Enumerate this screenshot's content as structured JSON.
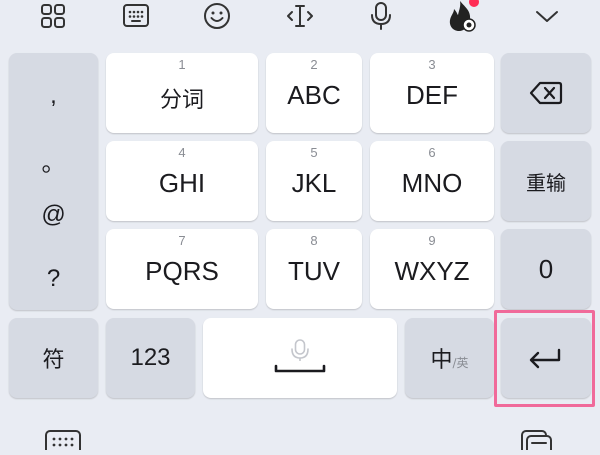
{
  "toolbar": {
    "icons": [
      "grid-icon",
      "keyboard-icon",
      "emoji-icon",
      "text-cursor-icon",
      "microphone-icon",
      "flame-icon",
      "chevron-down-icon"
    ],
    "notification_dot_color": "#ff2d55"
  },
  "punctuation": [
    ",",
    "。",
    "@",
    "?"
  ],
  "keys": {
    "k1": {
      "num": "1",
      "label": "分词"
    },
    "k2": {
      "num": "2",
      "label": "ABC"
    },
    "k3": {
      "num": "3",
      "label": "DEF"
    },
    "k4": {
      "num": "4",
      "label": "GHI"
    },
    "k5": {
      "num": "5",
      "label": "JKL"
    },
    "k6": {
      "num": "6",
      "label": "MNO"
    },
    "k7": {
      "num": "7",
      "label": "PQRS"
    },
    "k8": {
      "num": "8",
      "label": "TUV"
    },
    "k9": {
      "num": "9",
      "label": "WXYZ"
    }
  },
  "right_column": {
    "retype": "重输",
    "zero": "0"
  },
  "bottom_row": {
    "symbols": "符",
    "numbers": "123",
    "lang_main": "中",
    "lang_alt": "/英"
  },
  "colors": {
    "background": "#e9ecf3",
    "key_white": "#ffffff",
    "key_gray": "#d6dae3",
    "highlight": "#f06a9a"
  }
}
